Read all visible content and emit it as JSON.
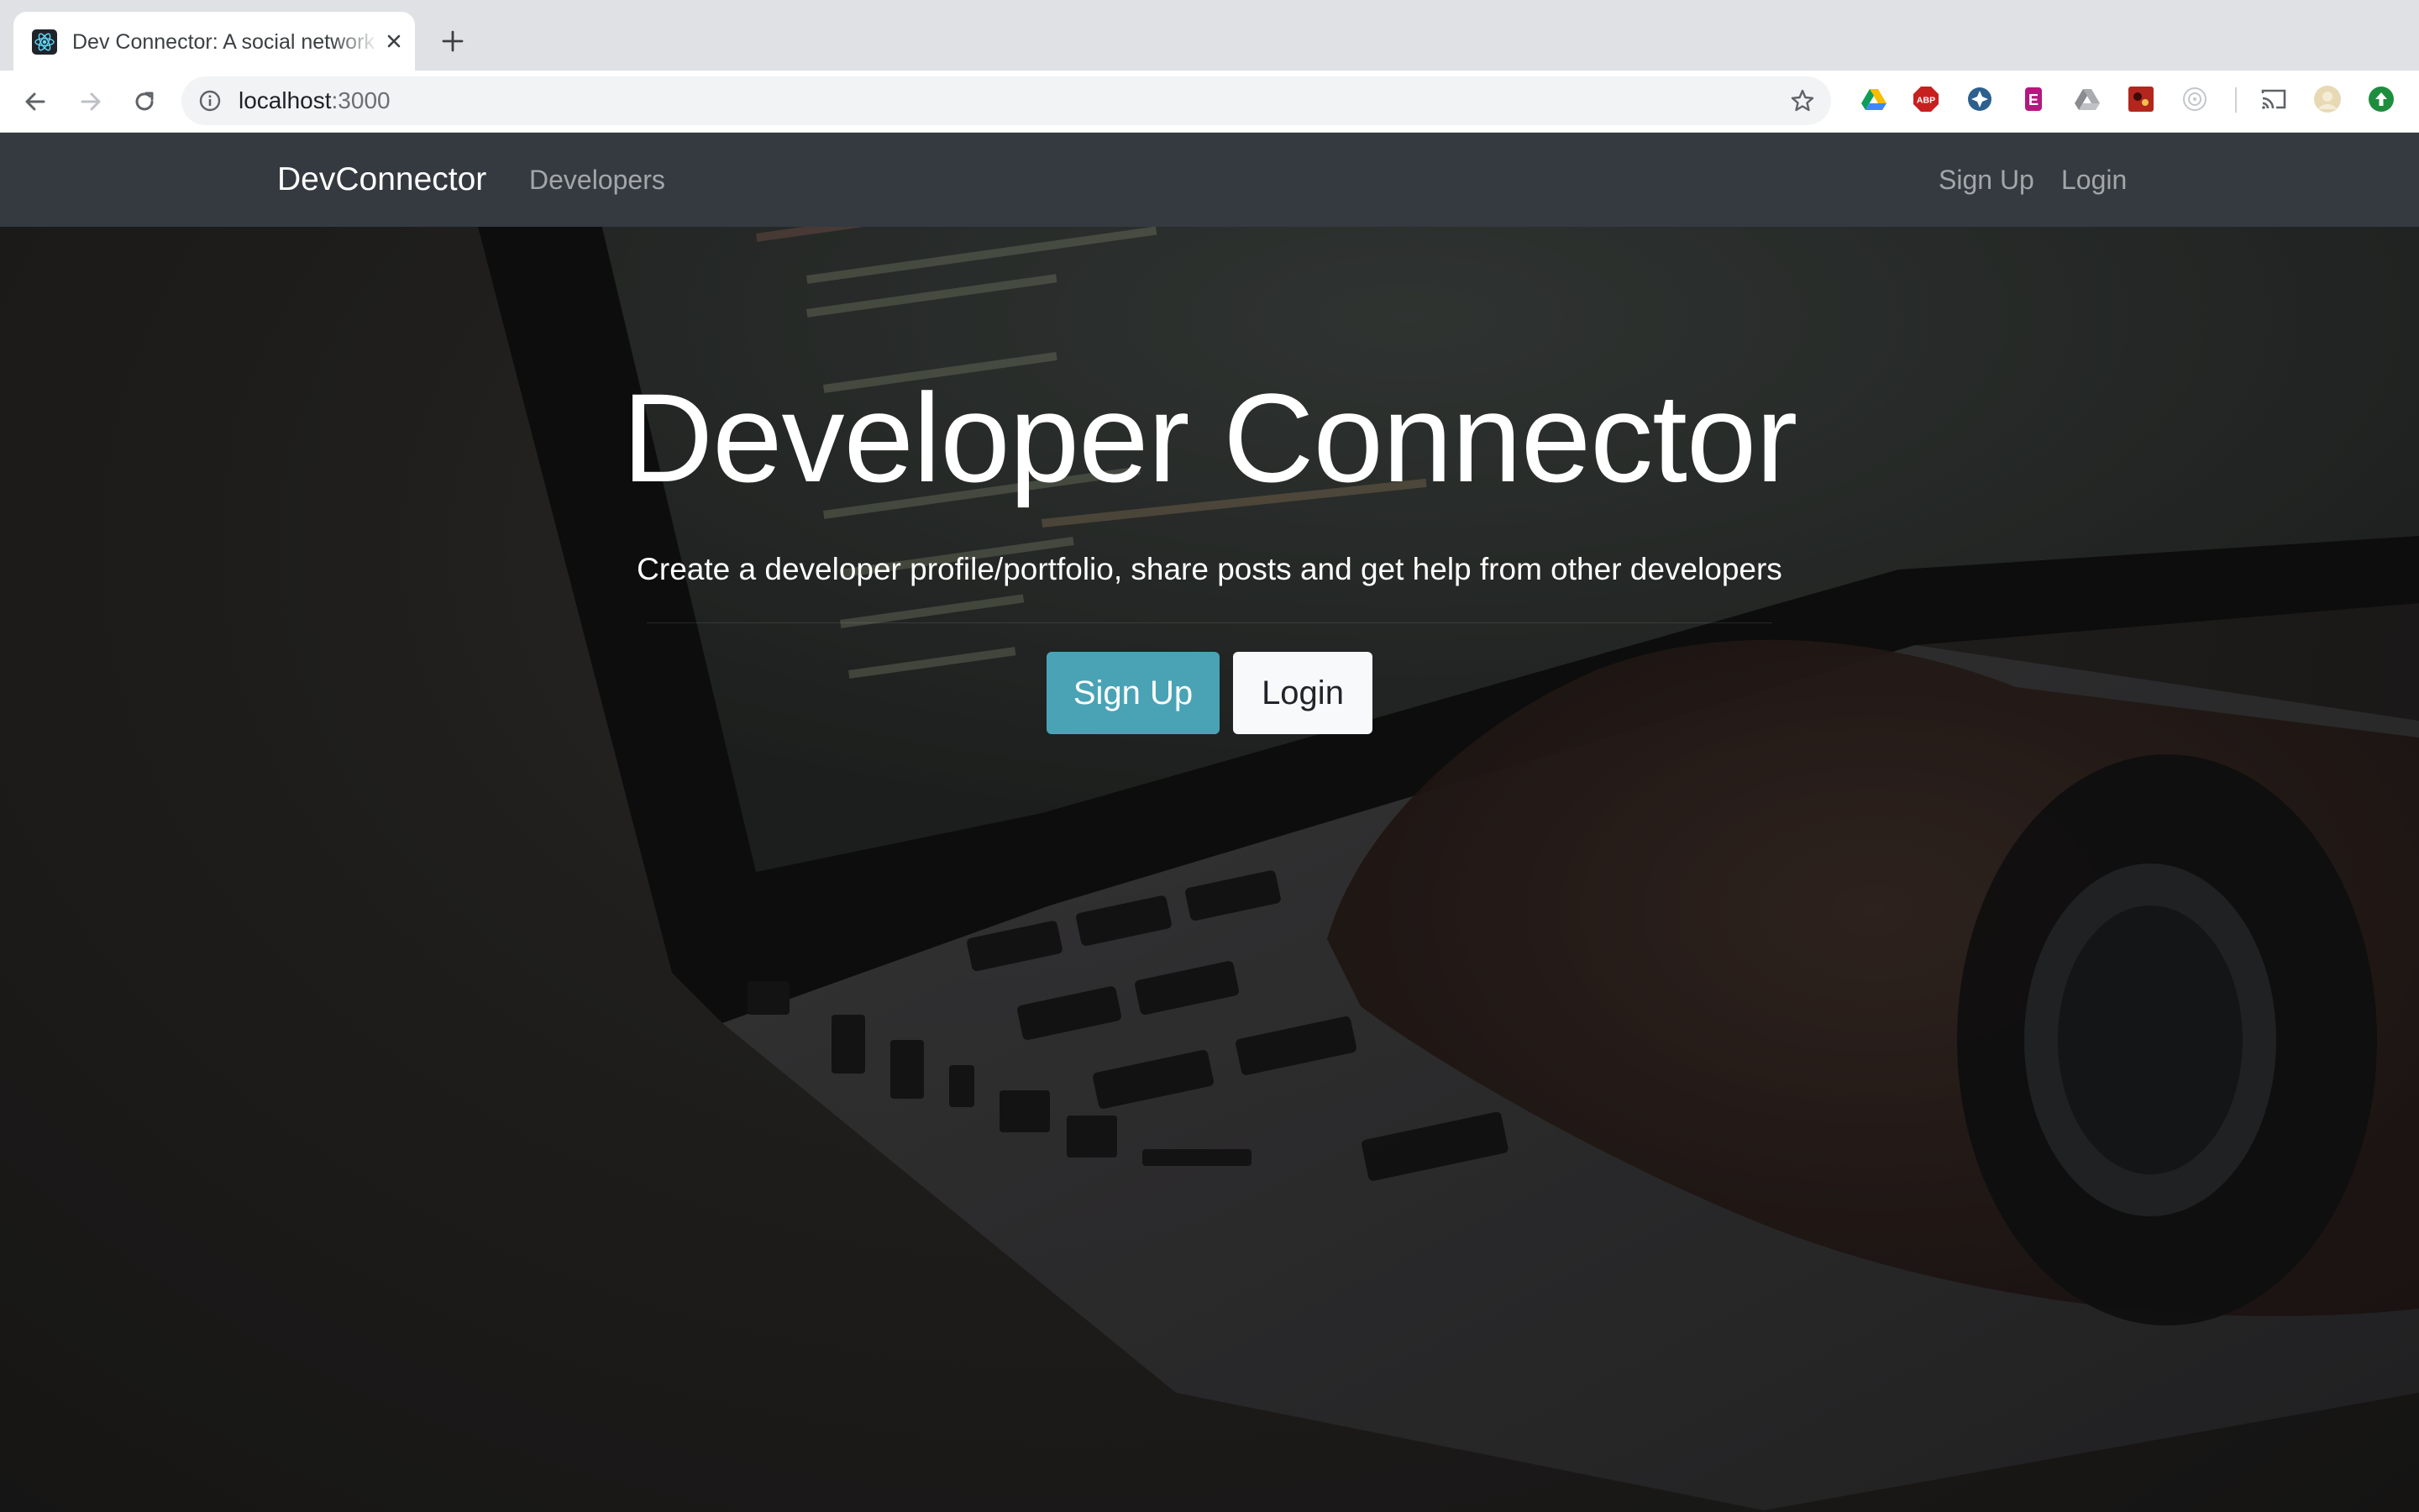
{
  "browser": {
    "tab": {
      "title": "Dev Connector: A social network for developers",
      "favicon": "react-icon"
    },
    "address": {
      "host": "localhost",
      "port": ":3000"
    },
    "extensions": [
      "google-drive-icon",
      "adblock-plus-icon",
      "extension-blue-icon",
      "extension-pink-icon",
      "drive-gray-icon",
      "extension-red-icon",
      "extension-target-icon",
      "cast-icon",
      "profile-avatar",
      "update-icon"
    ]
  },
  "navbar": {
    "brand": "DevConnector",
    "developers": "Developers",
    "signup": "Sign Up",
    "login": "Login"
  },
  "hero": {
    "title": "Developer Connector",
    "lead": "Create a developer profile/portfolio, share posts and get help from other developers",
    "signup_button": "Sign Up",
    "login_button": "Login"
  },
  "colors": {
    "navbar": "#343a40",
    "info_button": "#4aa3b5",
    "light_button": "#f8f9fa"
  }
}
